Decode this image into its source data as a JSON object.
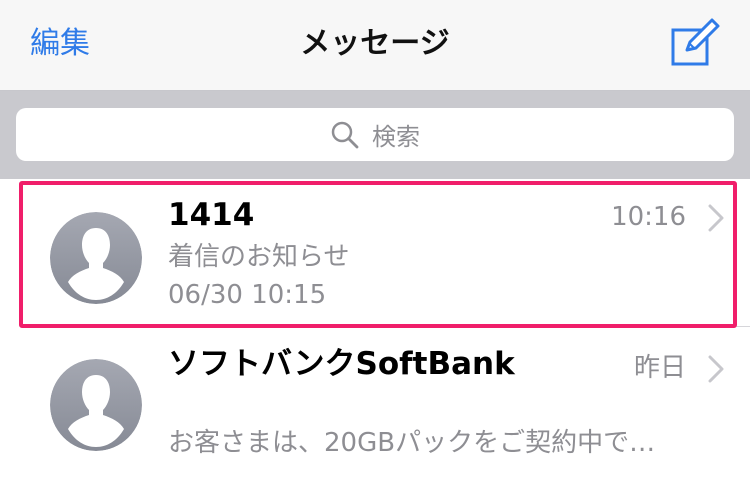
{
  "navbar": {
    "edit_label": "編集",
    "title": "メッセージ",
    "compose_icon": "compose-icon"
  },
  "search": {
    "placeholder": "検索",
    "icon": "search-icon"
  },
  "conversations": [
    {
      "sender": "1414",
      "time": "10:16",
      "preview_lines": [
        "着信のお知らせ",
        "06/30 10:15"
      ],
      "highlighted": true
    },
    {
      "sender": "ソフトバンクSoftBank",
      "time": "昨日",
      "preview_lines": [
        "お客さまは、20GBパックをご契約中で…"
      ],
      "highlighted": false
    }
  ],
  "colors": {
    "accent": "#2f7be8",
    "highlight": "#f01e6a",
    "secondary_text": "#8e8e93"
  }
}
